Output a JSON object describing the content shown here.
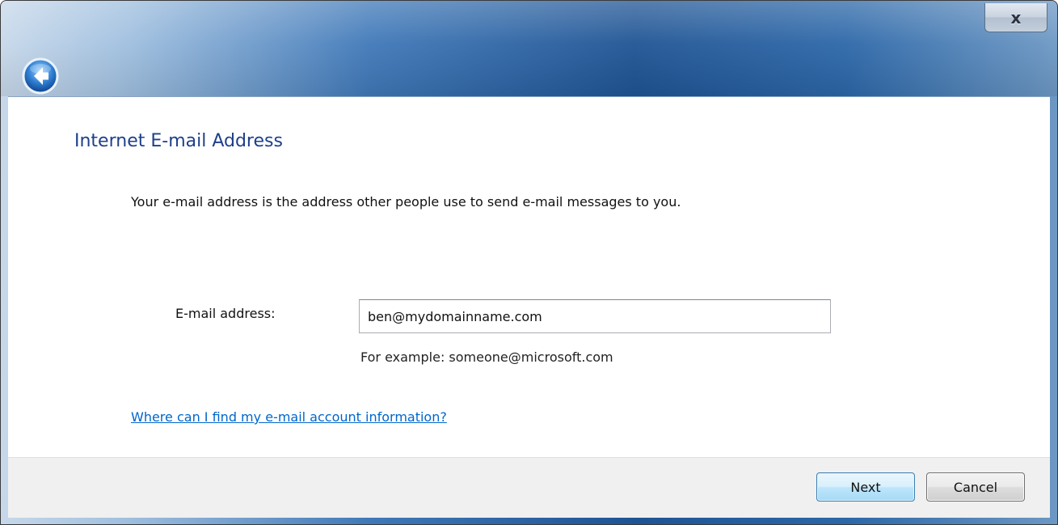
{
  "window": {
    "close_label": "x"
  },
  "page": {
    "title": "Internet E-mail Address",
    "description": "Your e-mail address is the address other people use to send e-mail messages to you."
  },
  "form": {
    "email_label": "E-mail address:",
    "email_value": "ben@mydomainname.com",
    "example": "For example: someone@microsoft.com"
  },
  "help": {
    "link_text": "Where can I find my e-mail account information?"
  },
  "footer": {
    "next_label": "Next",
    "cancel_label": "Cancel"
  },
  "colors": {
    "title": "#1e3f8a",
    "link": "#0066cc",
    "primary_button_border": "#3c7fb1"
  }
}
